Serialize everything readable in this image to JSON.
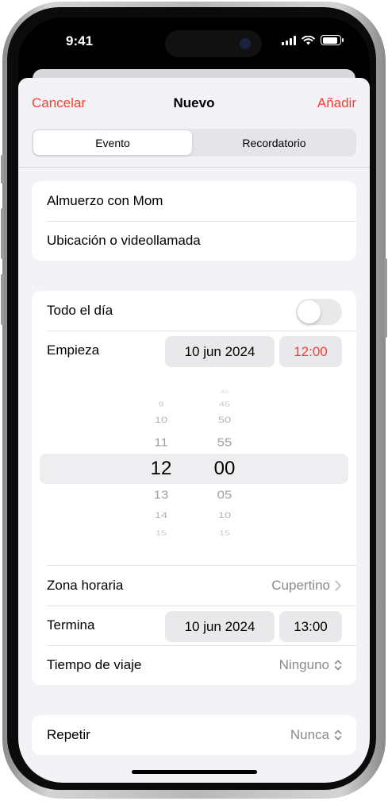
{
  "status_bar": {
    "time": "9:41"
  },
  "nav": {
    "cancel": "Cancelar",
    "title": "Nuevo",
    "add": "Añadir"
  },
  "segments": {
    "event": "Evento",
    "reminder": "Recordatorio",
    "selected": "Evento"
  },
  "title_card": {
    "title": "Almuerzo con Mom",
    "location_placeholder": "Ubicación o videollamada"
  },
  "all_day": {
    "label": "Todo el día",
    "on": false
  },
  "starts": {
    "label": "Empieza",
    "date": "10 jun 2024",
    "time": "12:00"
  },
  "time_picker": {
    "hours": [
      "9",
      "10",
      "11",
      "12",
      "13",
      "14",
      "15"
    ],
    "minutes": [
      "40",
      "45",
      "50",
      "55",
      "00",
      "05",
      "10",
      "15"
    ],
    "selected_hour": "12",
    "selected_minute": "00"
  },
  "timezone": {
    "label": "Zona horaria",
    "value": "Cupertino"
  },
  "ends": {
    "label": "Termina",
    "date": "10 jun 2024",
    "time": "13:00"
  },
  "travel": {
    "label": "Tiempo de viaje",
    "value": "Ninguno"
  },
  "repeat": {
    "label": "Repetir",
    "value": "Nunca"
  },
  "colors": {
    "accent": "#ff3b30",
    "background": "#f2f2f7",
    "card": "#ffffff",
    "secondary_text": "#8a8a8e"
  }
}
